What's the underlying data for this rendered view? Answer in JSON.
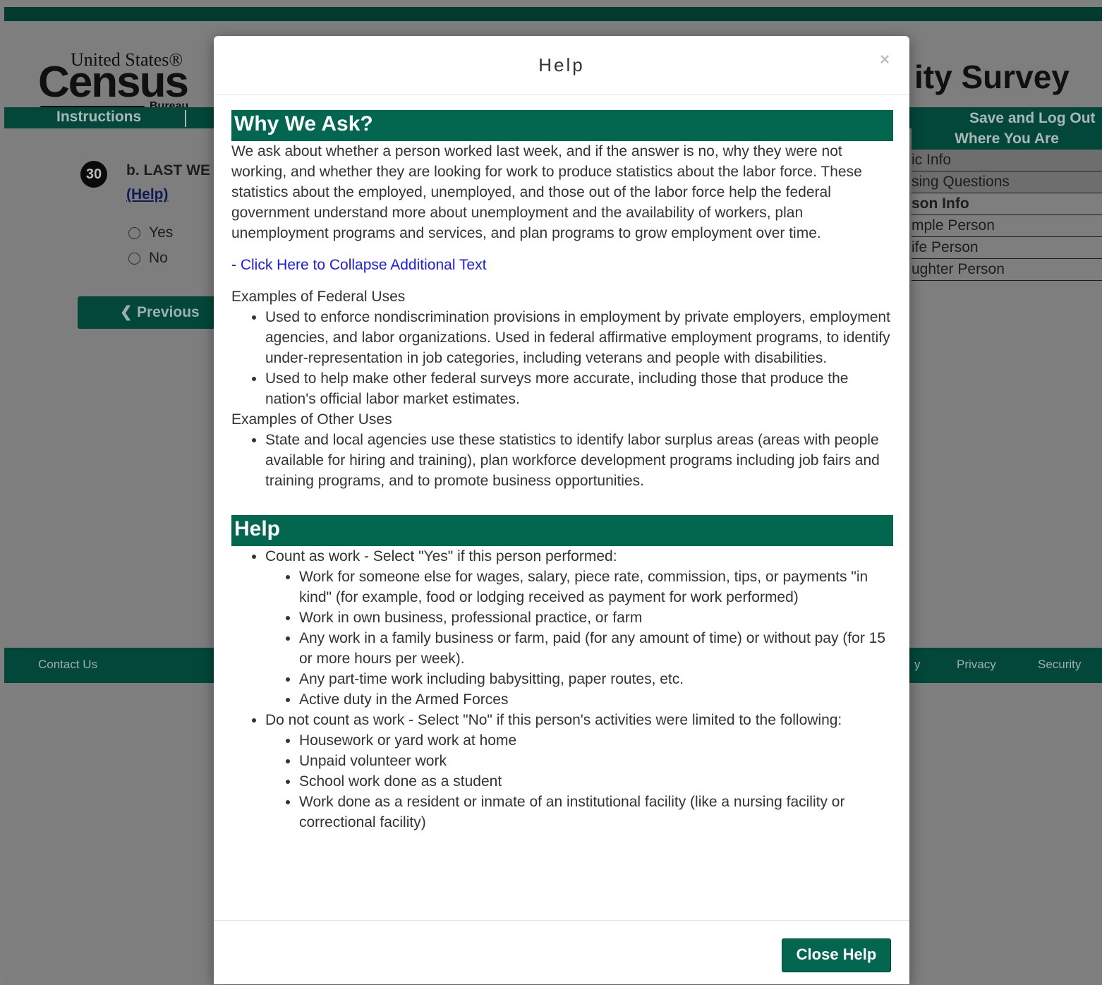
{
  "header": {
    "logo_top": "United States®",
    "logo_main": "Census",
    "logo_bottom": "Bureau",
    "survey_title": "ity Survey"
  },
  "nav": {
    "instructions": "Instructions",
    "save_logout": "Save and Log Out"
  },
  "question": {
    "number": "30",
    "text": "b. LAST WE",
    "help_link": "(Help)",
    "options": [
      "Yes",
      "No"
    ],
    "previous_button": "Previous"
  },
  "where_you_are": {
    "title": "Where You Are",
    "items": [
      "ic Info",
      "sing Questions",
      "son Info",
      "mple Person",
      "ife Person",
      "ughter Person"
    ]
  },
  "footer": {
    "contact": "Contact Us",
    "partial": "y",
    "privacy": "Privacy",
    "security": "Security"
  },
  "modal": {
    "title": "Help",
    "close_x": "×",
    "why_heading": "Why We Ask?",
    "why_text": "We ask about whether a person worked last week, and if the answer is no, why they were not working, and whether they are looking for work to produce statistics about the labor force. These statistics about the employed, unemployed, and those out of the labor force help the federal government understand more about unemployment and the availability of workers, plan unemployment programs and services, and plan programs to grow employment over time.",
    "collapse_link": "- Click Here to Collapse Additional Text",
    "federal_heading": "Examples of Federal Uses",
    "federal_uses": [
      "Used to enforce nondiscrimination provisions in employment by private employers, employment agencies, and labor organizations. Used in federal affirmative employment programs, to identify under-representation in job categories, including veterans and people with disabilities.",
      "Used to help make other federal surveys more accurate, including those that produce the nation's official labor market estimates."
    ],
    "other_heading": "Examples of Other Uses",
    "other_uses": [
      "State and local agencies use these statistics to identify labor surplus areas (areas with people available for hiring and training), plan workforce development programs including job fairs and training programs, and to promote business opportunities."
    ],
    "help_heading": "Help",
    "count_label": "Count as work - Select \"Yes\" if this person performed:",
    "count_items": [
      "Work for someone else for wages, salary, piece rate, commission, tips, or payments \"in kind\" (for example, food or lodging received as payment for work performed)",
      "Work in own business, professional practice, or farm",
      "Any work in a family business or farm, paid (for any amount of time) or without pay (for 15 or more hours per week).",
      "Any part-time work including babysitting, paper routes, etc.",
      "Active duty in the Armed Forces"
    ],
    "notcount_label": "Do not count as work - Select \"No\" if this person's activities were limited to the following:",
    "notcount_items": [
      "Housework or yard work at home",
      "Unpaid volunteer work",
      "School work done as a student",
      "Work done as a resident or inmate of an institutional facility (like a nursing facility or correctional facility)"
    ],
    "close_button": "Close Help"
  },
  "colors": {
    "brand_green": "#03664f",
    "dark_green": "#03473a",
    "link_blue": "#1a1aff"
  }
}
